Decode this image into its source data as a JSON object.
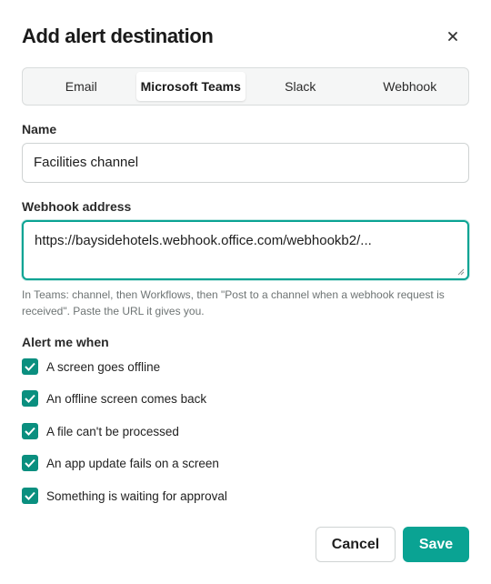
{
  "dialog": {
    "title": "Add alert destination",
    "close_icon": "close-icon"
  },
  "tabs": [
    {
      "label": "Email",
      "active": false
    },
    {
      "label": "Microsoft Teams",
      "active": true
    },
    {
      "label": "Slack",
      "active": false
    },
    {
      "label": "Webhook",
      "active": false
    }
  ],
  "name_field": {
    "label": "Name",
    "value": "Facilities channel"
  },
  "webhook_field": {
    "label": "Webhook address",
    "value": "https://baysidehotels.webhook.office.com/webhookb2/...",
    "help": "In Teams: channel, then Workflows, then \"Post to a channel when a webhook request is received\". Paste the URL it gives you."
  },
  "alerts": {
    "label": "Alert me when",
    "options": [
      {
        "label": "A screen goes offline",
        "checked": true
      },
      {
        "label": "An offline screen comes back",
        "checked": true
      },
      {
        "label": "A file can't be processed",
        "checked": true
      },
      {
        "label": "An app update fails on a screen",
        "checked": true
      },
      {
        "label": "Something is waiting for approval",
        "checked": true
      }
    ]
  },
  "actions": {
    "cancel_label": "Cancel",
    "save_label": "Save"
  },
  "colors": {
    "accent": "#0aa393",
    "checkbox": "#0a8f7f"
  }
}
